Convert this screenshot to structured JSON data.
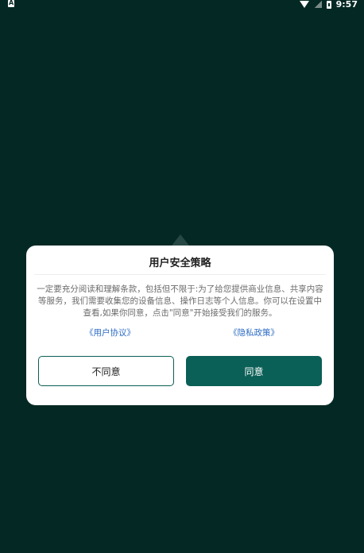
{
  "status_bar": {
    "left_icon": "A",
    "time": "9:57",
    "icons": [
      "wifi-icon",
      "signal-icon",
      "battery-icon"
    ]
  },
  "dialog": {
    "title": "用户安全策略",
    "body": "一定要充分阅读和理解条款，包括但不限于:为了给您提供商业信息、共享内容等服务，我们需要收集您的设备信息、操作日志等个人信息。你可以在设置中查看,如果你同意，点击\"同意\"开始接受我们的服务。",
    "links": {
      "agreement": "《用户协议》",
      "privacy": "《隐私政策》"
    },
    "buttons": {
      "disagree": "不同意",
      "agree": "同意"
    }
  },
  "colors": {
    "background": "#042924",
    "accent": "#0a5f56",
    "link": "#2d6cc4"
  }
}
